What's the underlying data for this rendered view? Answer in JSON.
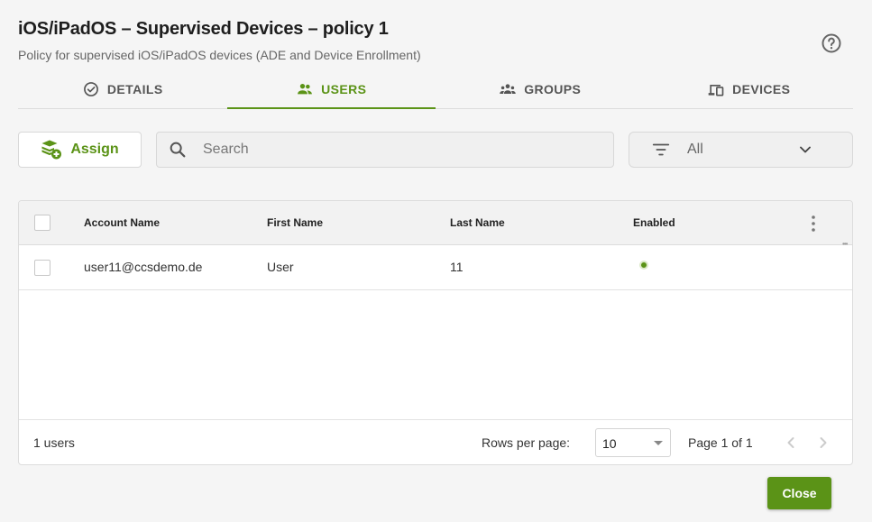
{
  "header": {
    "title": "iOS/iPadOS – Supervised Devices – policy 1",
    "subtitle": "Policy for supervised iOS/iPadOS devices (ADE and Device Enrollment)",
    "help_icon": "help-circle-icon"
  },
  "tabs": [
    {
      "label": "DETAILS",
      "icon": "check-circle-icon",
      "active": false
    },
    {
      "label": "USERS",
      "icon": "people-icon",
      "active": true
    },
    {
      "label": "GROUPS",
      "icon": "groups-icon",
      "active": false
    },
    {
      "label": "DEVICES",
      "icon": "devices-icon",
      "active": false
    }
  ],
  "toolbar": {
    "assign_label": "Assign",
    "search_placeholder": "Search",
    "filter_value": "All"
  },
  "table": {
    "columns": [
      "Account Name",
      "First Name",
      "Last Name",
      "Enabled"
    ],
    "rows": [
      {
        "account_name": "user11@ccsdemo.de",
        "first_name": "User",
        "last_name": "11",
        "enabled": true
      }
    ],
    "footer": {
      "count_label": "1 users",
      "rows_per_page_label": "Rows per page:",
      "rows_per_page_value": "10",
      "page_info": "Page 1 of 1"
    }
  },
  "actions": {
    "close_label": "Close"
  },
  "colors": {
    "accent": "#5b9317",
    "background": "#f5f5f5"
  }
}
